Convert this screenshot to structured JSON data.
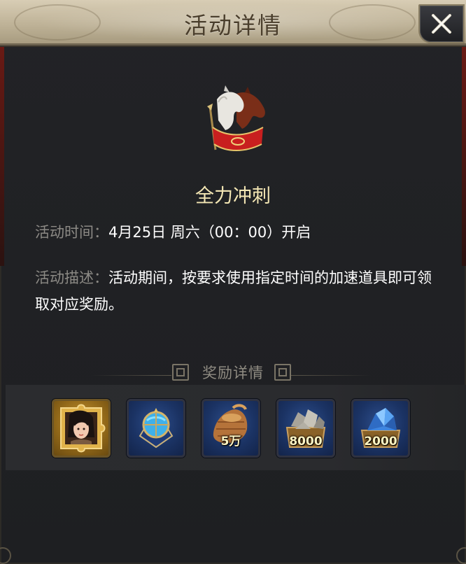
{
  "header": {
    "title": "活动详情"
  },
  "activity": {
    "name": "全力冲刺",
    "time_label": "活动时间：",
    "time_value": "4月25日  周六（00：00）开启",
    "desc_label": "活动描述：",
    "desc_value": "活动期间，按要求使用指定时间的加速道具即可领取对应奖励。"
  },
  "rewards": {
    "title": "奖励详情",
    "items": [
      {
        "icon": "hero-portrait-fragment-icon",
        "qty": ""
      },
      {
        "icon": "speedup-orb-icon",
        "qty": ""
      },
      {
        "icon": "food-sack-icon",
        "qty": "5万"
      },
      {
        "icon": "stone-crate-icon",
        "qty": "8000"
      },
      {
        "icon": "crystal-crate-icon",
        "qty": "2000"
      }
    ]
  },
  "colors": {
    "title_text": "#4a3e2c",
    "activity_name": "#f4e7b4",
    "label_gray": "#8c8a85",
    "reward_frame_blue": "#1b3364",
    "reward_frame_gold": "#8f6618"
  }
}
